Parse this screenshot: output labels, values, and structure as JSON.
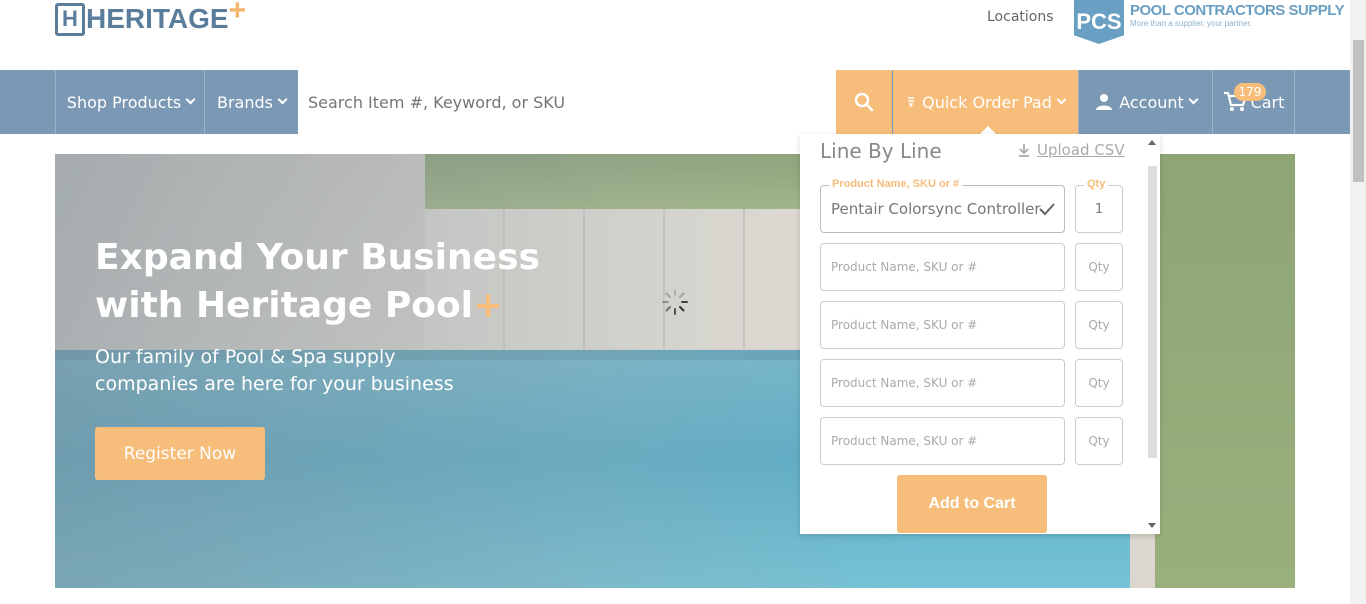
{
  "header": {
    "logo_text": "HERITAGE",
    "logo_plus": "+",
    "locations_label": "Locations",
    "partner_logo": {
      "badge": "PCS",
      "title": "POOL CONTRACTORS SUPPLY",
      "tagline": "More than a supplier, your partner."
    }
  },
  "nav": {
    "shop_products": "Shop Products",
    "brands": "Brands",
    "search_placeholder": "Search Item #, Keyword, or SKU",
    "quick_order_pad": "Quick Order Pad",
    "account": "Account",
    "cart": "Cart",
    "cart_count": "179"
  },
  "hero": {
    "title_line1": "Expand Your Business",
    "title_line2": "with Heritage Pool",
    "title_plus": "+",
    "subtitle": "Our family of Pool & Spa supply companies  are here for your business",
    "register_button": "Register Now"
  },
  "quick_order": {
    "heading": "Line By Line",
    "upload_csv": "Upload CSV",
    "product_legend": "Product Name, SKU or #",
    "qty_legend": "Qty",
    "rows": [
      {
        "product": "Pentair Colorsync Controller",
        "qty": "1"
      },
      {
        "product_placeholder": "Product Name, SKU or #",
        "qty_placeholder": "Qty"
      },
      {
        "product_placeholder": "Product Name, SKU or #",
        "qty_placeholder": "Qty"
      },
      {
        "product_placeholder": "Product Name, SKU or #",
        "qty_placeholder": "Qty"
      },
      {
        "product_placeholder": "Product Name, SKU or #",
        "qty_placeholder": "Qty"
      }
    ],
    "add_to_cart": "Add to Cart"
  },
  "colors": {
    "nav_bg": "#7b98b5",
    "accent": "#f7bd7a",
    "brand_blue": "#5b7d9c"
  },
  "icons": [
    "search-icon",
    "filter-icon",
    "user-icon",
    "cart-icon",
    "download-icon",
    "check-icon",
    "spinner-icon"
  ]
}
